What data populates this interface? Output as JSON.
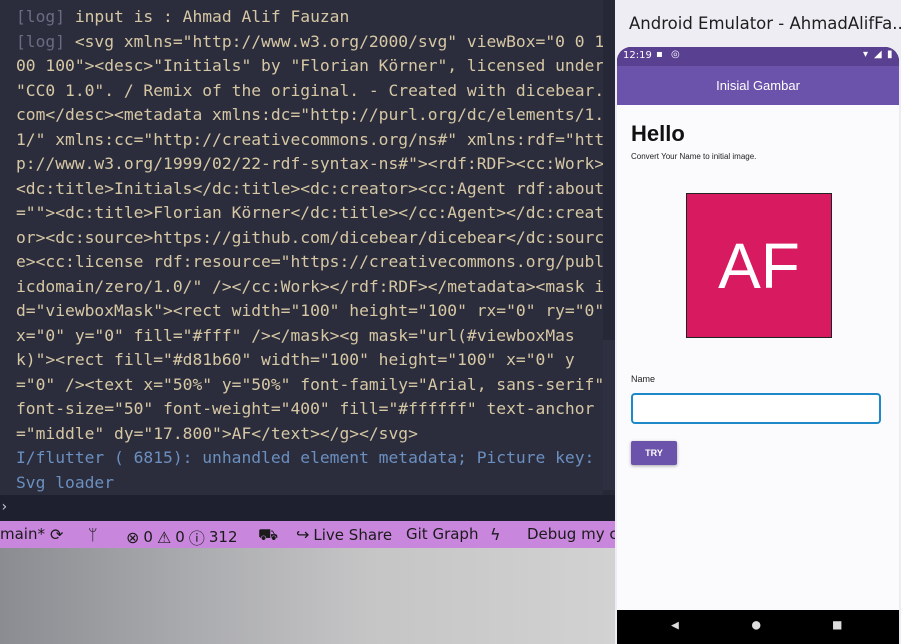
{
  "console": {
    "lines": [
      {
        "tag": "[log]",
        "text": " input is : Ahmad Alif Fauzan"
      },
      {
        "tag": "[log]",
        "text": " <svg xmlns=\"http://www.w3.org/2000/svg\" viewBox=\"0 0 1"
      },
      {
        "tag": "",
        "text": "00 100\"><desc>\"Initials\" by \"Florian Körner\", licensed under"
      },
      {
        "tag": "",
        "text": "\"CC0 1.0\". / Remix of the original. - Created with dicebear."
      },
      {
        "tag": "",
        "text": "com</desc><metadata xmlns:dc=\"http://purl.org/dc/elements/1."
      },
      {
        "tag": "",
        "text": "1/\" xmlns:cc=\"http://creativecommons.org/ns#\" xmlns:rdf=\"htt"
      },
      {
        "tag": "",
        "text": "p://www.w3.org/1999/02/22-rdf-syntax-ns#\"><rdf:RDF><cc:Work>"
      },
      {
        "tag": "",
        "text": "<dc:title>Initials</dc:title><dc:creator><cc:Agent rdf:about"
      },
      {
        "tag": "",
        "text": "=\"\"><dc:title>Florian Körner</dc:title></cc:Agent></dc:creat"
      },
      {
        "tag": "",
        "text": "or><dc:source>https://github.com/dicebear/dicebear</dc:sourc"
      },
      {
        "tag": "",
        "text": "e><cc:license rdf:resource=\"https://creativecommons.org/publ"
      },
      {
        "tag": "",
        "text": "icdomain/zero/1.0/\" /></cc:Work></rdf:RDF></metadata><mask i"
      },
      {
        "tag": "",
        "text": "d=\"viewboxMask\"><rect width=\"100\" height=\"100\" rx=\"0\" ry=\"0\""
      },
      {
        "tag": "",
        "text": "x=\"0\" y=\"0\" fill=\"#fff\" /></mask><g mask=\"url(#viewboxMas"
      },
      {
        "tag": "",
        "text": "k)\"><rect fill=\"#d81b60\" width=\"100\" height=\"100\" x=\"0\" y"
      },
      {
        "tag": "",
        "text": "=\"0\" /><text x=\"50%\" y=\"50%\" font-family=\"Arial, sans-serif\""
      },
      {
        "tag": "",
        "text": "font-size=\"50\" font-weight=\"400\" fill=\"#ffffff\" text-anchor"
      },
      {
        "tag": "",
        "text": "=\"middle\" dy=\"17.800\">AF</text></g></svg>"
      }
    ],
    "info_lines": [
      "I/flutter ( 6815): unhandled element metadata; Picture key:",
      "Svg loader"
    ]
  },
  "statusbar": {
    "branch": "main*",
    "errors": "0",
    "warnings": "0",
    "infos": "312",
    "live_share": "Live Share",
    "git_graph": "Git Graph",
    "debug": "Debug my co"
  },
  "emulator": {
    "window_title": "Android Emulator - AhmadAlifFa...",
    "clock": "12:19",
    "app_title": "Inisial Gambar",
    "hello": "Hello",
    "subtitle": "Convert Your Name to initial image.",
    "avatar_initials": "AF",
    "avatar_color": "#d81b60",
    "name_label": "Name",
    "name_value": "",
    "try_label": "TRY"
  }
}
